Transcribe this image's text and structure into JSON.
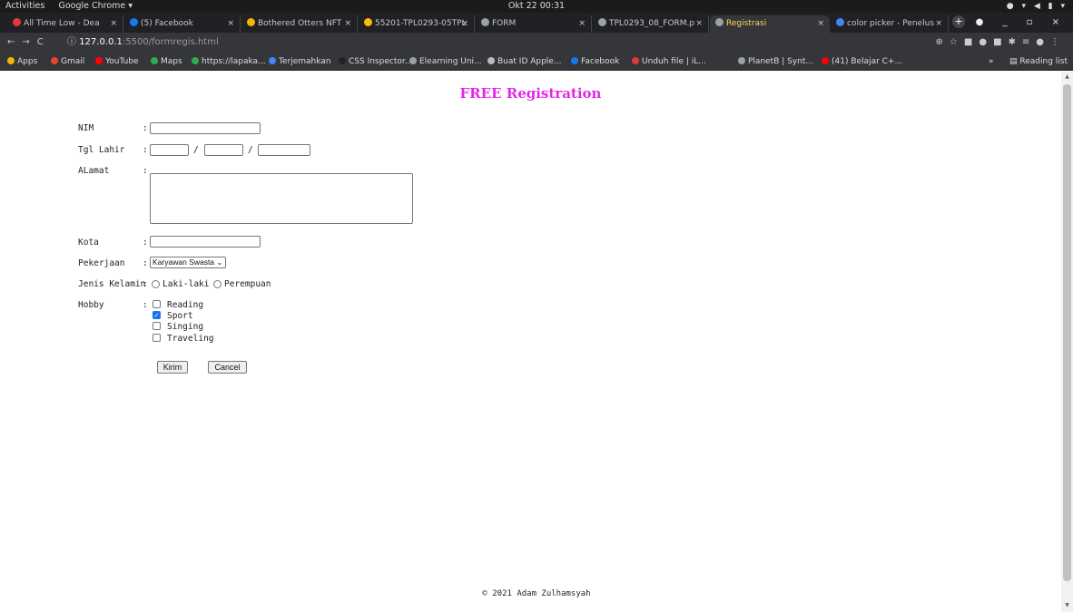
{
  "os": {
    "activities": "Activities",
    "app_menu": "Google Chrome ▾",
    "clock": "Okt 22  00:31"
  },
  "tabs": [
    {
      "title": "All Time Low - Dea",
      "color": "#e53935"
    },
    {
      "title": "(5) Facebook",
      "color": "#1877f2"
    },
    {
      "title": "Bothered Otters NFT",
      "color": "#f4b400"
    },
    {
      "title": "55201-TPL0293-05TPL",
      "color": "#fbbc04"
    },
    {
      "title": "FORM",
      "color": "#9aa0a6"
    },
    {
      "title": "TPL0293_08_FORM.p",
      "color": "#9aa0a6"
    },
    {
      "title": "Registrasi",
      "color": "#9aa0a6"
    },
    {
      "title": "color picker - Penelus",
      "color": "#4285f4"
    }
  ],
  "toolbar": {
    "url_host": "127.0.0.1",
    "url_path": ":5500/formregis.html"
  },
  "bookmarks": [
    {
      "label": "Apps",
      "color": "#f4b400"
    },
    {
      "label": "Gmail",
      "color": "#ea4335"
    },
    {
      "label": "YouTube",
      "color": "#ff0000"
    },
    {
      "label": "Maps",
      "color": "#34a853"
    },
    {
      "label": "https://lapaka...",
      "color": "#34a853"
    },
    {
      "label": "Terjemahkan",
      "color": "#4285f4"
    },
    {
      "label": "CSS Inspector...",
      "color": "#222222"
    },
    {
      "label": "Elearning Uni...",
      "color": "#9aa0a6"
    },
    {
      "label": "Buat ID Apple...",
      "color": "#bbbbbb"
    },
    {
      "label": "Facebook",
      "color": "#1877f2"
    },
    {
      "label": "Unduh file | iL...",
      "color": "#e53935"
    },
    {
      "label": "PlanetB | Synt...",
      "color": "#9aa0a6"
    },
    {
      "label": "(41) Belajar C+...",
      "color": "#ff0000"
    }
  ],
  "reading_list": "Reading list",
  "page": {
    "title": "FREE Registration",
    "colon": ":",
    "slash": "/",
    "labels": {
      "nim": "NIM",
      "tgl_lahir": "Tgl Lahir",
      "alamat": "ALamat",
      "kota": "Kota",
      "pekerjaan": "Pekerjaan",
      "jenis_kelamin": "Jenis Kelamin",
      "hobby": "Hobby"
    },
    "pekerjaan_selected": "Karyawan Swasta",
    "gender_options": [
      "Laki-laki",
      "Perempuan"
    ],
    "hobbies": [
      {
        "label": "Reading",
        "checked": false
      },
      {
        "label": "Sport",
        "checked": true
      },
      {
        "label": "Singing",
        "checked": false
      },
      {
        "label": "Traveling",
        "checked": false
      }
    ],
    "submit_label": "Kirim",
    "cancel_label": "Cancel",
    "footer": "© 2021 Adam Zulhamsyah"
  },
  "colors": {
    "title": "#e526e8",
    "active_tab_text": "#ffd95a"
  }
}
